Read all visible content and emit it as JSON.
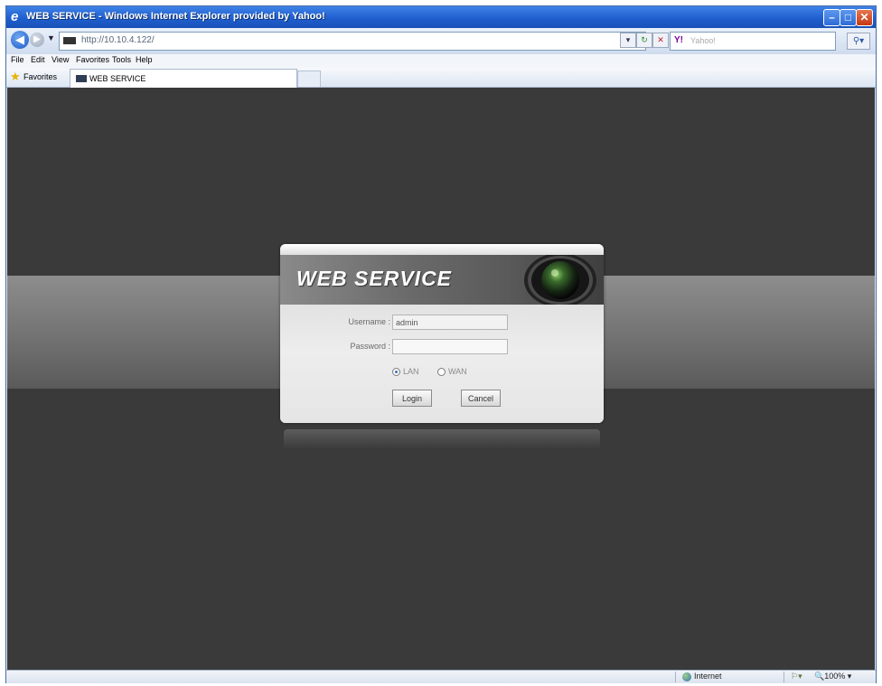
{
  "browser": {
    "title": "WEB SERVICE - Windows Internet Explorer provided by Yahoo!",
    "address": "http://10.10.4.122/",
    "search_placeholder": "Yahoo!",
    "search_brand": "Y!",
    "window_buttons": {
      "min": "–",
      "max": "□",
      "close": "✕"
    }
  },
  "menu": [
    "File",
    "Edit",
    "View",
    "Favorites",
    "Tools",
    "Help"
  ],
  "favorites": {
    "label": "Favorites",
    "tab_title": "WEB SERVICE"
  },
  "login": {
    "title": "WEB SERVICE",
    "username_label": "Username :",
    "username_value": "admin",
    "password_label": "Password :",
    "password_value": "",
    "network_options": [
      {
        "label": "LAN",
        "selected": true
      },
      {
        "label": "WAN",
        "selected": false
      }
    ],
    "login_button": "Login",
    "cancel_button": "Cancel"
  },
  "status": {
    "zone": "Internet",
    "zoom": "100%"
  },
  "icons": {
    "back": "back-arrow-icon",
    "forward": "forward-arrow-icon",
    "refresh": "refresh-icon",
    "stop": "stop-icon",
    "favorites": "star-icon",
    "camera": "camera-lens-icon",
    "zone": "globe-icon"
  }
}
